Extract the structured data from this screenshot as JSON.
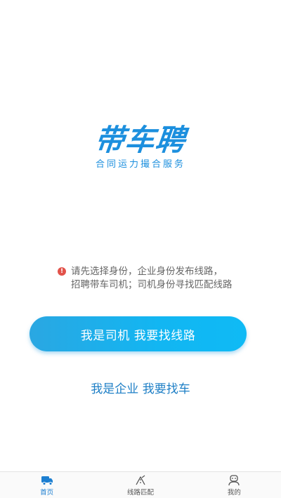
{
  "brand": {
    "title": "带车聘",
    "subtitle": "合同运力撮合服务"
  },
  "notice": {
    "icon": "alert-circle-icon",
    "line1": "请先选择身份，企业身份发布线路，",
    "line2": "招聘带车司机；司机身份寻找匹配线路"
  },
  "actions": {
    "driver_label": "我是司机 我要找线路",
    "company_label": "我是企业 我要找车"
  },
  "tabbar": {
    "items": [
      {
        "label": "首页",
        "icon": "truck-icon",
        "active": true
      },
      {
        "label": "线路匹配",
        "icon": "route-icon",
        "active": false
      },
      {
        "label": "我的",
        "icon": "user-icon",
        "active": false
      }
    ]
  },
  "colors": {
    "brand": "#1c8fde",
    "button_gradient_start": "#2aa7e2",
    "button_gradient_end": "#0fbaf5",
    "link": "#1e7fc6",
    "alert": "#e2524a",
    "tab_active": "#1d7fd1"
  }
}
